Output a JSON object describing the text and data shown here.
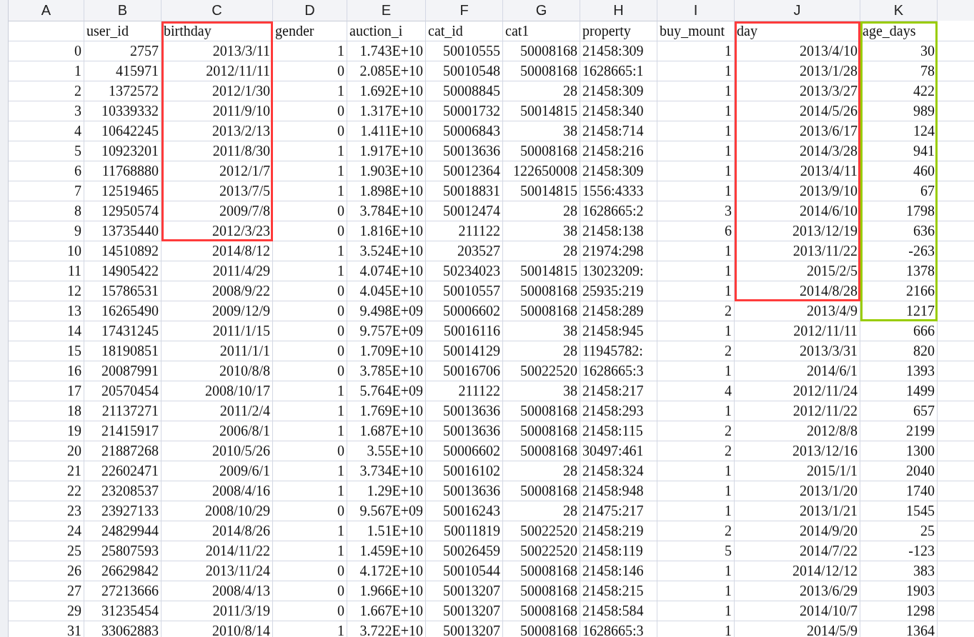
{
  "columns": [
    {
      "letter": "A",
      "kind": "number"
    },
    {
      "letter": "B",
      "kind": "number"
    },
    {
      "letter": "C",
      "kind": "number"
    },
    {
      "letter": "D",
      "kind": "number"
    },
    {
      "letter": "E",
      "kind": "number"
    },
    {
      "letter": "F",
      "kind": "number"
    },
    {
      "letter": "G",
      "kind": "number"
    },
    {
      "letter": "H",
      "kind": "text"
    },
    {
      "letter": "I",
      "kind": "number"
    },
    {
      "letter": "J",
      "kind": "number"
    },
    {
      "letter": "K",
      "kind": "number"
    }
  ],
  "header_row": [
    "user_id",
    "birthday",
    "gender",
    "auction_i",
    "cat_id",
    "cat1",
    "property",
    "buy_mount",
    "day",
    "age_days"
  ],
  "rows": [
    [
      "0",
      "2757",
      "2013/3/11",
      "1",
      "1.743E+10",
      "50010555",
      "50008168",
      "21458:309",
      "1",
      "2013/4/10",
      "30"
    ],
    [
      "1",
      "415971",
      "2012/11/11",
      "0",
      "2.085E+10",
      "50010548",
      "50008168",
      "1628665:1",
      "1",
      "2013/1/28",
      "78"
    ],
    [
      "2",
      "1372572",
      "2012/1/30",
      "1",
      "1.692E+10",
      "50008845",
      "28",
      "21458:309",
      "1",
      "2013/3/27",
      "422"
    ],
    [
      "3",
      "10339332",
      "2011/9/10",
      "0",
      "1.317E+10",
      "50001732",
      "50014815",
      "21458:340",
      "1",
      "2014/5/26",
      "989"
    ],
    [
      "4",
      "10642245",
      "2013/2/13",
      "0",
      "1.411E+10",
      "50006843",
      "38",
      "21458:714",
      "1",
      "2013/6/17",
      "124"
    ],
    [
      "5",
      "10923201",
      "2011/8/30",
      "1",
      "1.917E+10",
      "50013636",
      "50008168",
      "21458:216",
      "1",
      "2014/3/28",
      "941"
    ],
    [
      "6",
      "11768880",
      "2012/1/7",
      "1",
      "1.903E+10",
      "50012364",
      "122650008",
      "21458:309",
      "1",
      "2013/4/11",
      "460"
    ],
    [
      "7",
      "12519465",
      "2013/7/5",
      "1",
      "1.898E+10",
      "50018831",
      "50014815",
      "1556:4333",
      "1",
      "2013/9/10",
      "67"
    ],
    [
      "8",
      "12950574",
      "2009/7/8",
      "0",
      "3.784E+10",
      "50012474",
      "28",
      "1628665:2",
      "3",
      "2014/6/10",
      "1798"
    ],
    [
      "9",
      "13735440",
      "2012/3/23",
      "0",
      "1.816E+10",
      "211122",
      "38",
      "21458:138",
      "6",
      "2013/12/19",
      "636"
    ],
    [
      "10",
      "14510892",
      "2014/8/12",
      "1",
      "3.524E+10",
      "203527",
      "28",
      "21974:298",
      "1",
      "2013/11/22",
      "-263"
    ],
    [
      "11",
      "14905422",
      "2011/4/29",
      "1",
      "4.074E+10",
      "50234023",
      "50014815",
      "13023209:",
      "1",
      "2015/2/5",
      "1378"
    ],
    [
      "12",
      "15786531",
      "2008/9/22",
      "0",
      "4.045E+10",
      "50010557",
      "50008168",
      "25935:219",
      "1",
      "2014/8/28",
      "2166"
    ],
    [
      "13",
      "16265490",
      "2009/12/9",
      "0",
      "9.498E+09",
      "50006602",
      "50008168",
      "21458:289",
      "2",
      "2013/4/9",
      "1217"
    ],
    [
      "14",
      "17431245",
      "2011/1/15",
      "0",
      "9.757E+09",
      "50016116",
      "38",
      "21458:945",
      "1",
      "2012/11/11",
      "666"
    ],
    [
      "15",
      "18190851",
      "2011/1/1",
      "0",
      "1.709E+10",
      "50014129",
      "28",
      "11945782:",
      "2",
      "2013/3/31",
      "820"
    ],
    [
      "16",
      "20087991",
      "2010/8/8",
      "0",
      "3.785E+10",
      "50016706",
      "50022520",
      "1628665:3",
      "1",
      "2014/6/1",
      "1393"
    ],
    [
      "17",
      "20570454",
      "2008/10/17",
      "1",
      "5.764E+09",
      "211122",
      "38",
      "21458:217",
      "4",
      "2012/11/24",
      "1499"
    ],
    [
      "18",
      "21137271",
      "2011/2/4",
      "1",
      "1.769E+10",
      "50013636",
      "50008168",
      "21458:293",
      "1",
      "2012/11/22",
      "657"
    ],
    [
      "19",
      "21415917",
      "2006/8/1",
      "1",
      "1.687E+10",
      "50013636",
      "50008168",
      "21458:115",
      "2",
      "2012/8/8",
      "2199"
    ],
    [
      "20",
      "21887268",
      "2010/5/26",
      "0",
      "3.55E+10",
      "50006602",
      "50008168",
      "30497:461",
      "2",
      "2013/12/16",
      "1300"
    ],
    [
      "21",
      "22602471",
      "2009/6/1",
      "1",
      "3.734E+10",
      "50016102",
      "28",
      "21458:324",
      "1",
      "2015/1/1",
      "2040"
    ],
    [
      "22",
      "23208537",
      "2008/4/16",
      "1",
      "1.29E+10",
      "50013636",
      "50008168",
      "21458:948",
      "1",
      "2013/1/20",
      "1740"
    ],
    [
      "23",
      "23927133",
      "2008/10/29",
      "0",
      "9.567E+09",
      "50016243",
      "28",
      "21475:217",
      "1",
      "2013/1/21",
      "1545"
    ],
    [
      "24",
      "24829944",
      "2014/8/26",
      "1",
      "1.51E+10",
      "50011819",
      "50022520",
      "21458:219",
      "2",
      "2014/9/20",
      "25"
    ],
    [
      "25",
      "25807593",
      "2014/11/22",
      "1",
      "1.459E+10",
      "50026459",
      "50022520",
      "21458:119",
      "5",
      "2014/7/22",
      "-123"
    ],
    [
      "26",
      "26629842",
      "2013/11/24",
      "0",
      "4.172E+10",
      "50010544",
      "50008168",
      "21458:146",
      "1",
      "2014/12/12",
      "383"
    ],
    [
      "27",
      "27213666",
      "2008/4/13",
      "0",
      "1.966E+10",
      "50013207",
      "50008168",
      "21458:215",
      "1",
      "2013/6/29",
      "1903"
    ],
    [
      "29",
      "31235454",
      "2011/3/19",
      "0",
      "1.667E+10",
      "50013207",
      "50008168",
      "21458:584",
      "1",
      "2014/10/7",
      "1298"
    ],
    [
      "31",
      "33062883",
      "2010/8/14",
      "1",
      "3.722E+10",
      "50013207",
      "50008168",
      "1628665:3",
      "1",
      "2014/5/9",
      "1364"
    ]
  ],
  "highlights": [
    {
      "color": "#ff3b3b"
    },
    {
      "color": "#ff3b3b"
    },
    {
      "color": "#99cc00"
    }
  ]
}
